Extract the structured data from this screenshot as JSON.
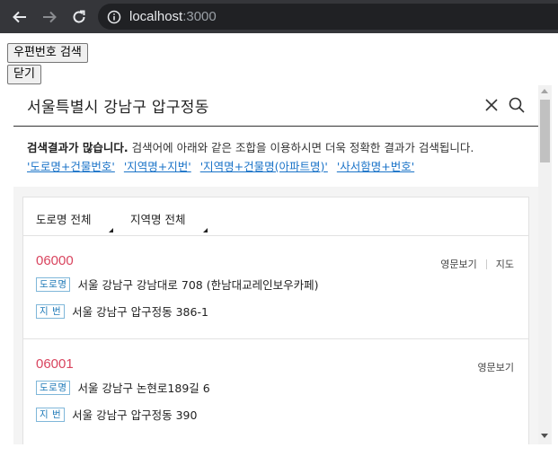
{
  "browser": {
    "url_host": "localhost",
    "url_port": ":3000"
  },
  "page": {
    "search_button": "우편번호 검색",
    "close_button": "닫기"
  },
  "widget": {
    "query": "서울특별시 강남구 압구정동",
    "notice_strong": "검색결과가 많습니다.",
    "notice_text": "검색어에 아래와 같은 조합을 이용하시면 더욱 정확한 결과가 검색됩니다.",
    "hints": [
      "'도로명+건물번호'",
      "'지역명+지번'",
      "'지역명+건물명(아파트명)'",
      "'사서함명+번호'"
    ],
    "filters": {
      "road": "도로명 전체",
      "area": "지역명 전체"
    },
    "results": [
      {
        "zip": "06000",
        "english_view": "영문보기",
        "map": "지도",
        "road_badge": "도로명",
        "road_address": "서울 강남구 강남대로 708 (한남대교레인보우카페)",
        "jibun_badge": "지 번",
        "jibun_address": "서울 강남구 압구정동 386-1"
      },
      {
        "zip": "06001",
        "english_view": "영문보기",
        "road_badge": "도로명",
        "road_address": "서울 강남구 논현로189길 6",
        "jibun_badge": "지 번",
        "jibun_address": "서울 강남구 압구정동 390"
      }
    ]
  }
}
